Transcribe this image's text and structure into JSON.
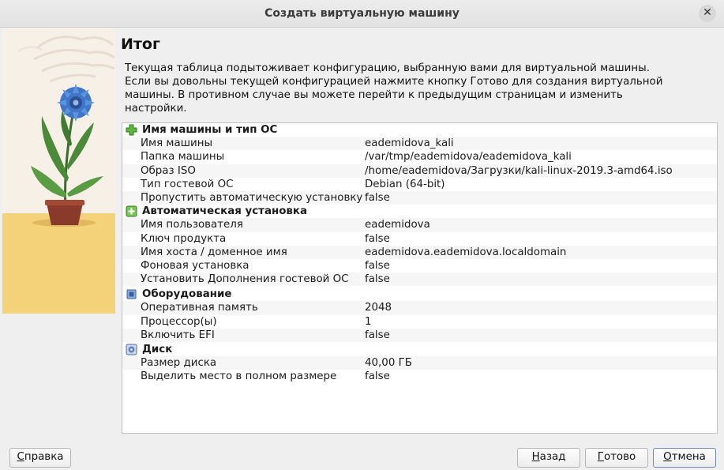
{
  "window": {
    "title": "Создать виртуальную машину"
  },
  "page": {
    "heading": "Итог",
    "description": "Текущая таблица подытоживает конфигурацию, выбранную вами для виртуальной машины. Если вы довольны текущей конфигурацией нажмите кнопку Готово для создания виртуальной машины. В противном случае вы можете перейти к предыдущим страницам и изменить настройки."
  },
  "summary": {
    "name_os": {
      "title": "Имя машины и тип ОС",
      "rows": [
        {
          "key": "Имя машины",
          "value": "eademidova_kali"
        },
        {
          "key": "Папка машины",
          "value": "/var/tmp/eademidova/eademidova_kali"
        },
        {
          "key": "Образ ISO",
          "value": "/home/eademidova/Загрузки/kali-linux-2019.3-amd64.iso"
        },
        {
          "key": "Тип гостевой ОС",
          "value": "Debian (64-bit)"
        },
        {
          "key": "Пропустить автоматическую установку",
          "value": "false"
        }
      ]
    },
    "unattended": {
      "title": "Автоматическая установка",
      "rows": [
        {
          "key": "Имя пользователя",
          "value": "eademidova"
        },
        {
          "key": "Ключ продукта",
          "value": "false"
        },
        {
          "key": "Имя хоста / доменное имя",
          "value": "eademidova.eademidova.localdomain"
        },
        {
          "key": "Фоновая установка",
          "value": "false"
        },
        {
          "key": "Установить Дополнения гостевой ОС",
          "value": "false"
        }
      ]
    },
    "hardware": {
      "title": "Оборудование",
      "rows": [
        {
          "key": "Оперативная память",
          "value": "2048"
        },
        {
          "key": "Процессор(ы)",
          "value": "1"
        },
        {
          "key": "Включить EFI",
          "value": "false"
        }
      ]
    },
    "disk": {
      "title": "Диск",
      "rows": [
        {
          "key": "Размер диска",
          "value": "40,00 ГБ"
        },
        {
          "key": "Выделить место в полном размере",
          "value": "false"
        }
      ]
    }
  },
  "buttons": {
    "help": {
      "first": "С",
      "rest": "правка"
    },
    "back": {
      "first": "Н",
      "rest": "азад"
    },
    "finish": {
      "first": "Г",
      "rest": "отово"
    },
    "cancel": {
      "first": "О",
      "rest": "тмена"
    }
  },
  "icons": {
    "name_os": "green-cross-icon",
    "unattended": "green-plus-icon",
    "hardware": "chip-icon",
    "disk": "disk-icon",
    "close": "close-icon"
  }
}
